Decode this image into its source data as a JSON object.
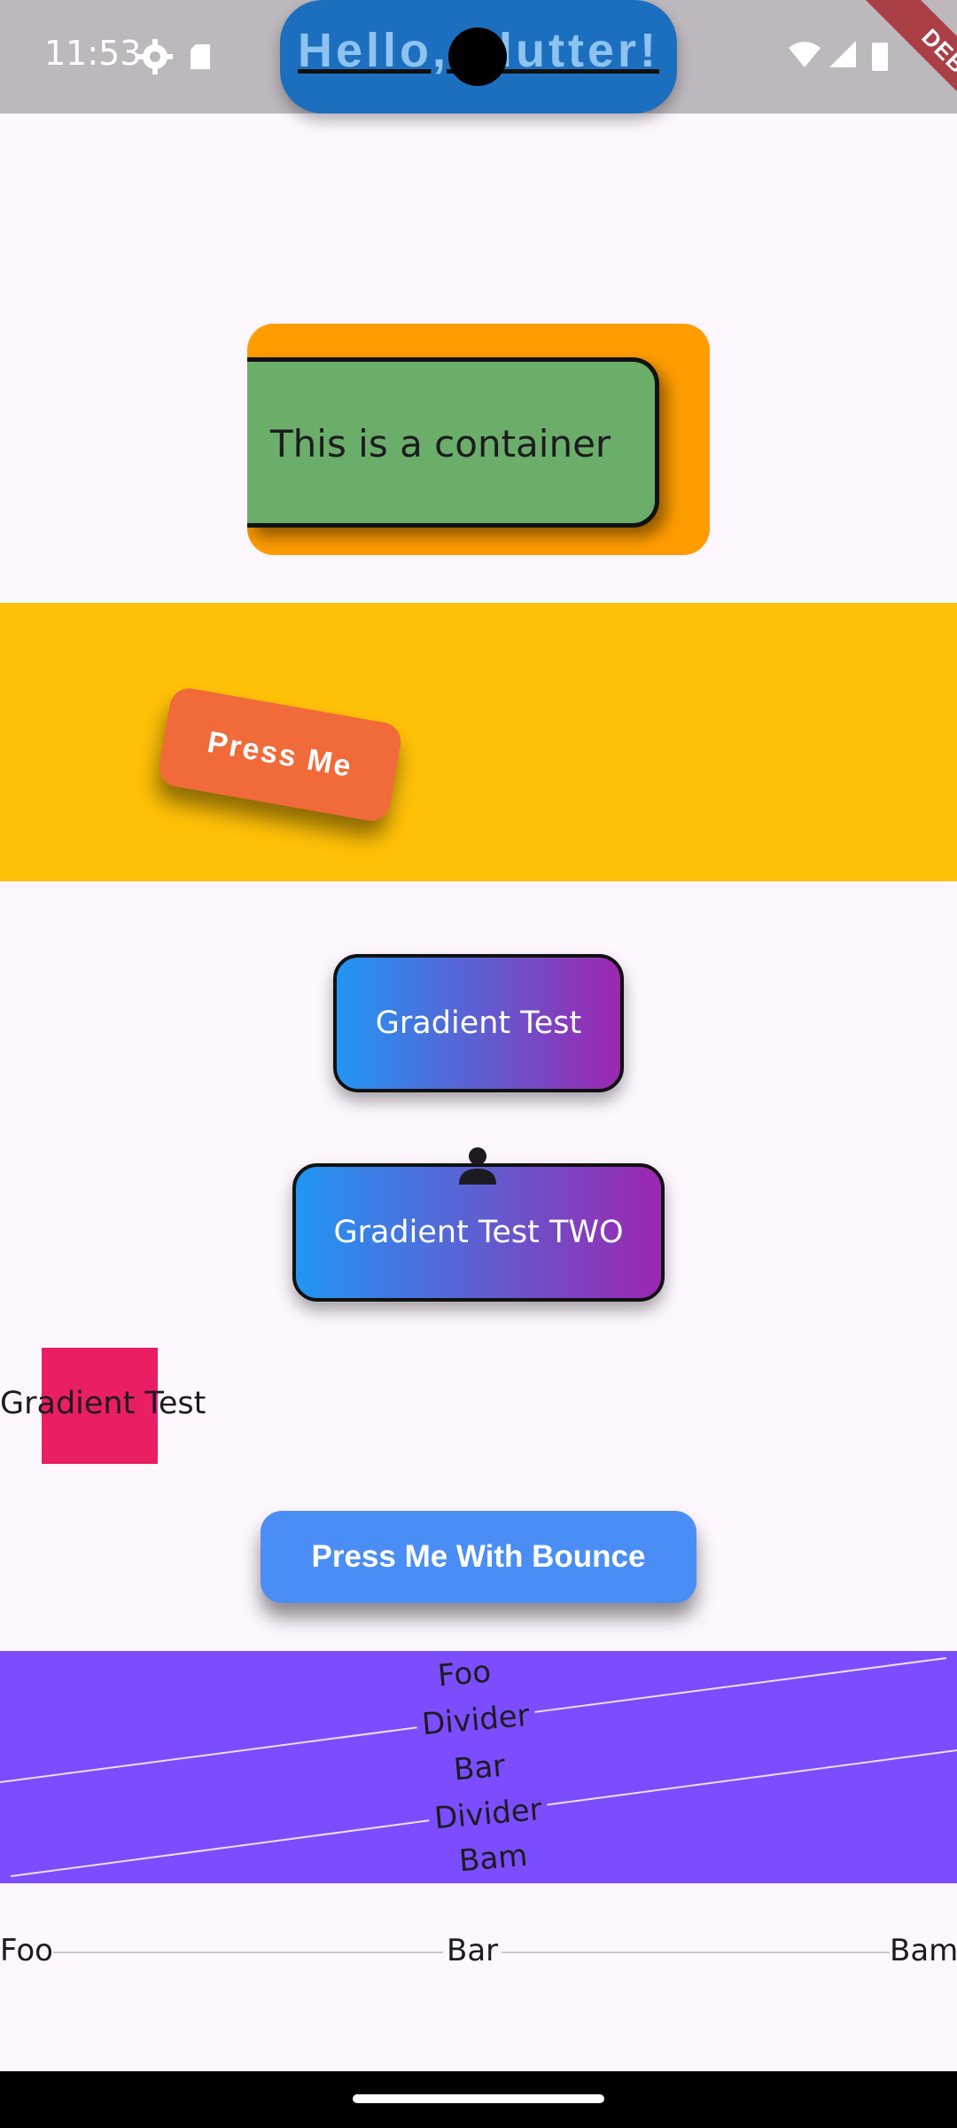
{
  "status_bar": {
    "time": "11:53",
    "icons_left": [
      "settings-icon",
      "sd-card-icon"
    ],
    "icons_right": [
      "wifi-icon",
      "signal-icon",
      "battery-icon"
    ],
    "background": "#BDB8BD"
  },
  "app_bar": {
    "title": "Hello, Flutter!",
    "pill_color": "#1C6FBE",
    "text_color": "#8EC3F0"
  },
  "debug_banner": {
    "label": "DEBUG",
    "color": "#A8323A"
  },
  "container_section": {
    "outer_color": "#FF9D00",
    "inner_color": "#6BAE6A",
    "text": "This is a container"
  },
  "amber_section": {
    "background": "#FFC107",
    "button_label": "Press Me",
    "button_color": "#F16A3A"
  },
  "gradient_buttons": {
    "first_label": "Gradient Test",
    "second_label": "Gradient Test TWO",
    "gradient_start": "#2196F3",
    "gradient_end": "#9C27B0",
    "icon": "person-icon"
  },
  "pink_tile": {
    "label": "Gradient Test",
    "color": "#E91E63"
  },
  "bounce_button": {
    "label": "Press Me With Bounce",
    "color": "#4A8EF5"
  },
  "purple_section": {
    "background": "#7C4DFF",
    "items": [
      "Foo",
      "Divider",
      "Bar",
      "Divider",
      "Bam"
    ]
  },
  "divider_row": {
    "items": [
      "Foo",
      "Bar",
      "Bam"
    ]
  }
}
